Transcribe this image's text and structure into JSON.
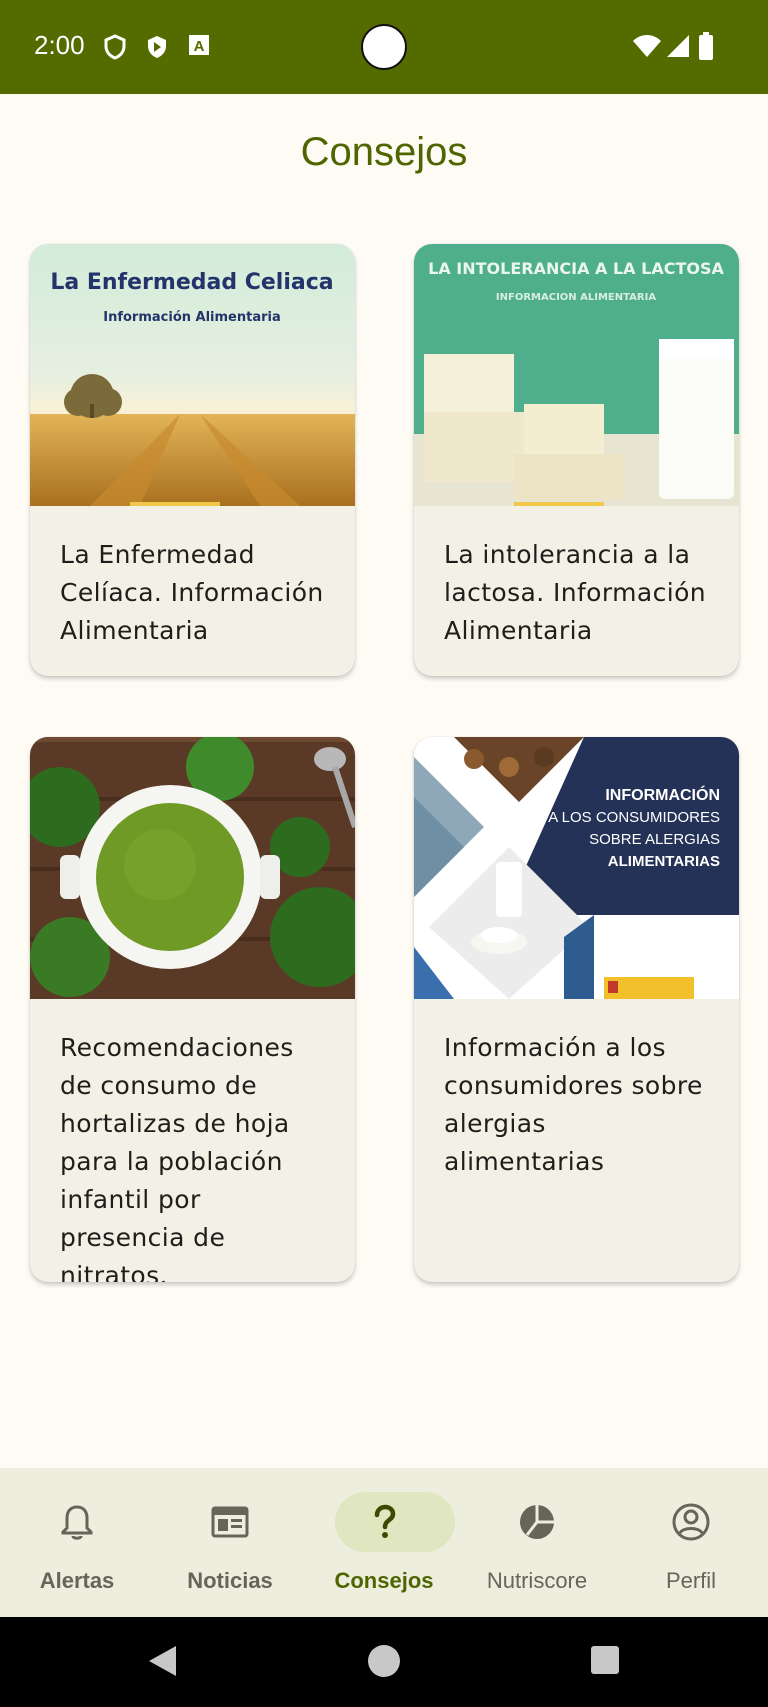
{
  "status_bar": {
    "time": "2:00"
  },
  "page": {
    "title": "Consejos"
  },
  "cards": [
    {
      "image_title": "La Enfermedad Celiaca",
      "image_subtitle": "Información Alimentaria",
      "text": "La Enfermedad Celíaca. Información Alimentaria"
    },
    {
      "image_title": "LA INTOLERANCIA A LA LACTOSA",
      "image_subtitle": "INFORMACION ALIMENTARIA",
      "text": "La intolerancia a la lactosa. Información Alimentaria"
    },
    {
      "text": "Recomendaciones de consumo de hortalizas de hoja para la población infantil por presencia de nitratos."
    },
    {
      "image_title_1": "INFORMACIÓN",
      "image_title_2": "A LOS CONSUMIDORES",
      "image_title_3": "SOBRE ALERGIAS",
      "image_title_4": "ALIMENTARIAS",
      "text": "Información a los consumidores sobre alergias alimentarias"
    }
  ],
  "bottom_nav": [
    {
      "label": "Alertas",
      "icon": "bell-icon"
    },
    {
      "label": "Noticias",
      "icon": "newspaper-icon"
    },
    {
      "label": "Consejos",
      "icon": "question-icon",
      "active": true
    },
    {
      "label": "Nutriscore",
      "icon": "pie-chart-icon"
    },
    {
      "label": "Perfil",
      "icon": "account-circle-icon"
    }
  ],
  "colors": {
    "primary": "#546b00",
    "background": "#fdfbf4",
    "card": "#f3f1e6",
    "nav_active": "#dfe6c0"
  }
}
